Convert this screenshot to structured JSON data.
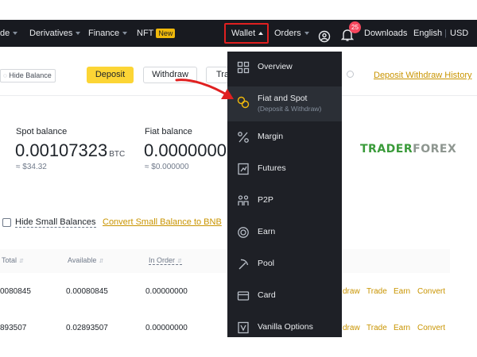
{
  "nav": {
    "items": [
      {
        "label": "de"
      },
      {
        "label": "Derivatives"
      },
      {
        "label": "Finance"
      },
      {
        "label": "NFT",
        "badge": "New"
      }
    ],
    "wallet_label": "Wallet",
    "orders_label": "Orders",
    "notification_count": "25",
    "downloads_label": "Downloads",
    "language_label": "English",
    "currency_label": "USD"
  },
  "actions": {
    "hide_balance": "Hide Balance",
    "deposit": "Deposit",
    "withdraw": "Withdraw",
    "transfer": "Tra",
    "history": "Deposit Withdraw History"
  },
  "balances": {
    "spot": {
      "label": "Spot balance",
      "value": "0.00107323",
      "unit": "BTC",
      "usd": "≈ $34.32"
    },
    "fiat": {
      "label": "Fiat balance",
      "value": "0.0000000",
      "usd": "≈ $0.000000"
    }
  },
  "watermark": {
    "part1": "TRADER",
    "part2": "FOREX"
  },
  "filters": {
    "hide_small": "Hide Small Balances",
    "convert_small": "Convert Small Balance to BNB"
  },
  "table": {
    "headers": [
      "Total",
      "Available",
      "In Order"
    ],
    "rows": [
      {
        "total": "0080845",
        "available": "0.00080845",
        "in_order": "0.00000000",
        "actions": [
          "draw",
          "Trade",
          "Earn",
          "Convert"
        ]
      },
      {
        "total": "893507",
        "available": "0.02893507",
        "in_order": "0.00000000",
        "actions": [
          "draw",
          "Trade",
          "Earn",
          "Convert"
        ]
      }
    ]
  },
  "dropdown": {
    "items": [
      {
        "label": "Overview",
        "icon": "grid-icon"
      },
      {
        "label": "Fiat and Spot",
        "sub": "(Deposit & Withdraw)",
        "icon": "fiat-spot-icon"
      },
      {
        "label": "Margin",
        "icon": "percent-icon"
      },
      {
        "label": "Futures",
        "icon": "futures-icon"
      },
      {
        "label": "P2P",
        "icon": "p2p-icon"
      },
      {
        "label": "Earn",
        "icon": "earn-icon"
      },
      {
        "label": "Pool",
        "icon": "pickaxe-icon"
      },
      {
        "label": "Card",
        "icon": "card-icon"
      },
      {
        "label": "Vanilla Options",
        "icon": "options-icon"
      }
    ]
  },
  "colors": {
    "accent": "#f0b90b",
    "annotation": "#e02020",
    "nav_bg": "#181a20",
    "dropdown_bg": "#1e2026"
  }
}
